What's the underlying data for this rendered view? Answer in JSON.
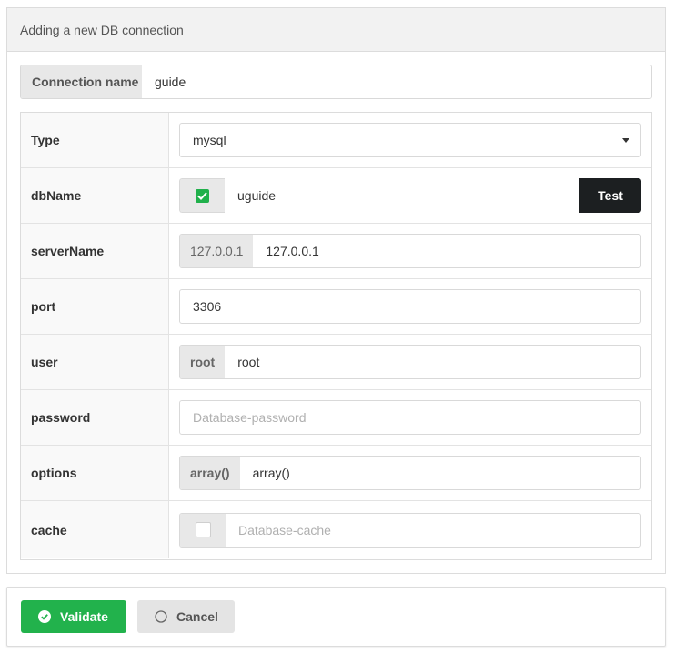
{
  "panel": {
    "title": "Adding a new DB connection"
  },
  "connection": {
    "label": "Connection name",
    "value": "guide"
  },
  "fields": {
    "type": {
      "label": "Type",
      "value": "mysql"
    },
    "dbname": {
      "label": "dbName",
      "value": "uguide",
      "checked": true,
      "test_label": "Test"
    },
    "servername": {
      "label": "serverName",
      "prefix": "127.0.0.1",
      "value": "127.0.0.1"
    },
    "port": {
      "label": "port",
      "value": "3306"
    },
    "user": {
      "label": "user",
      "prefix": "root",
      "value": "root"
    },
    "password": {
      "label": "password",
      "value": "",
      "placeholder": "Database-password"
    },
    "options": {
      "label": "options",
      "prefix": "array()",
      "value": "array()"
    },
    "cache": {
      "label": "cache",
      "checked": false,
      "value": "",
      "placeholder": "Database-cache"
    }
  },
  "footer": {
    "validate_label": "Validate",
    "cancel_label": "Cancel"
  },
  "colors": {
    "validate": "#22b24c",
    "test_button": "#1c1f21",
    "checkbox_checked": "#20b04b"
  },
  "icons": {
    "validate": "check-circle-icon",
    "cancel": "circle-outline-icon",
    "type_select": "caret-down-icon"
  }
}
